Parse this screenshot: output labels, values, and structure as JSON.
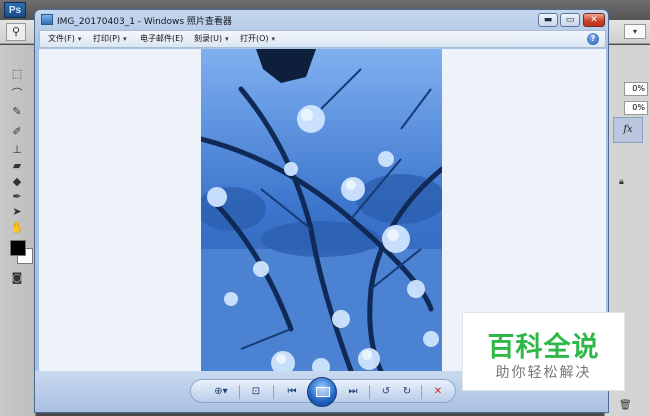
{
  "photoshop": {
    "logo": "Ps",
    "right_panel": {
      "field1": "0%",
      "field2": "0%",
      "fx_label": "fx"
    }
  },
  "viewer": {
    "title": "IMG_20170403_1 - Windows 照片查看器",
    "window_buttons": {
      "minimize": "▬",
      "maximize": "▭",
      "close": "✕"
    },
    "menu": [
      {
        "label": "文件(F)",
        "has_caret": true
      },
      {
        "label": "打印(P)",
        "has_caret": true
      },
      {
        "label": "电子邮件(E)",
        "has_caret": false
      },
      {
        "label": "刻录(U)",
        "has_caret": true
      },
      {
        "label": "打开(O)",
        "has_caret": true
      }
    ],
    "help_icon": "?",
    "controls": {
      "zoom": "⊕▾",
      "actual_size": "⊡",
      "previous": "⏮",
      "next": "⏭",
      "rotate_ccw": "↺",
      "rotate_cw": "↻",
      "delete": "✕"
    },
    "photo_tint": "#2f63b8"
  },
  "watermark": {
    "main": "百科全说",
    "sub": "助你轻松解决",
    "main_color": "#2fb84a"
  }
}
